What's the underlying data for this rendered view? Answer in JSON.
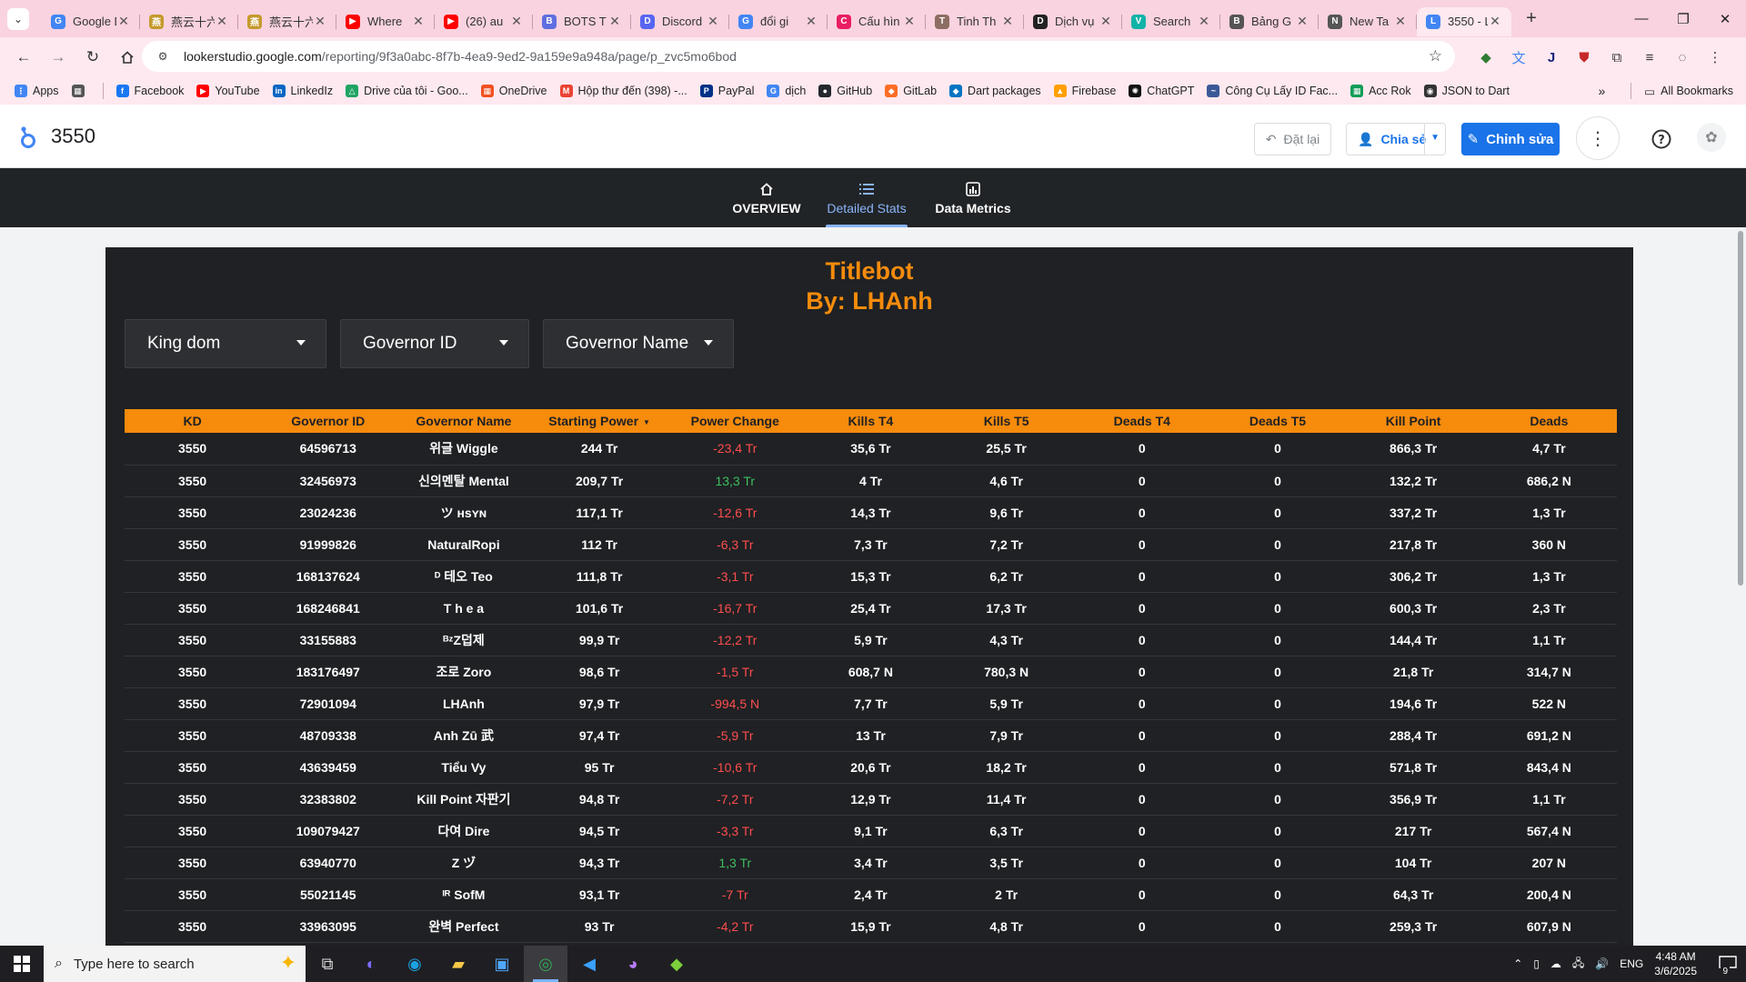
{
  "browser": {
    "tabs": [
      {
        "title": "Google Dịch",
        "favicon_color": "#4285f4",
        "favicon_glyph": "G"
      },
      {
        "title": "燕云十六声",
        "favicon_color": "#c49a2c",
        "favicon_glyph": "燕"
      },
      {
        "title": "燕云十六声",
        "favicon_color": "#c49a2c",
        "favicon_glyph": "燕"
      },
      {
        "title": "Where",
        "favicon_color": "#ff0000",
        "favicon_glyph": "▶"
      },
      {
        "title": "(26) au",
        "favicon_color": "#ff0000",
        "favicon_glyph": "▶"
      },
      {
        "title": "BOTS T",
        "favicon_color": "#5f6ee0",
        "favicon_glyph": "B"
      },
      {
        "title": "Discord",
        "favicon_color": "#5865f2",
        "favicon_glyph": "D"
      },
      {
        "title": "đổi gi",
        "favicon_color": "#4285f4",
        "favicon_glyph": "G"
      },
      {
        "title": "Cấu hìn",
        "favicon_color": "#e91e63",
        "favicon_glyph": "C"
      },
      {
        "title": "Tinh Th",
        "favicon_color": "#8d6e63",
        "favicon_glyph": "T"
      },
      {
        "title": "Dịch vụ",
        "favicon_color": "#222222",
        "favicon_glyph": "D"
      },
      {
        "title": "Search",
        "favicon_color": "#12b3a8",
        "favicon_glyph": "V"
      },
      {
        "title": "Bảng G",
        "favicon_color": "#555555",
        "favicon_glyph": "B"
      },
      {
        "title": "New Ta",
        "favicon_color": "#555555",
        "favicon_glyph": "N"
      },
      {
        "title": "3550 - L",
        "favicon_color": "#4285f4",
        "favicon_glyph": "L",
        "active": true
      }
    ],
    "url_host": "lookerstudio.google.com",
    "url_path": "/reporting/9f3a0abc-8f7b-4ea9-9ed2-9a159e9a948a/page/p_zvc5mo6bod",
    "bookmarks": [
      {
        "label": "Apps",
        "color": "#4285f4",
        "glyph": "⋮"
      },
      {
        "label": "",
        "color": "#555555",
        "glyph": "▦"
      },
      {
        "label": "Facebook",
        "color": "#1877f2",
        "glyph": "f"
      },
      {
        "label": "YouTube",
        "color": "#ff0000",
        "glyph": "▶"
      },
      {
        "label": "LinkedIz",
        "color": "#0a66c2",
        "glyph": "in"
      },
      {
        "label": "Drive của tôi - Goo...",
        "color": "#1fa463",
        "glyph": "△"
      },
      {
        "label": "OneDrive",
        "color": "#f25022",
        "glyph": "▦"
      },
      {
        "label": "Hộp thư đến (398) -...",
        "color": "#ea4335",
        "glyph": "M"
      },
      {
        "label": "PayPal",
        "color": "#003087",
        "glyph": "P"
      },
      {
        "label": "dịch",
        "color": "#4285f4",
        "glyph": "G"
      },
      {
        "label": "GitHub",
        "color": "#24292f",
        "glyph": "●"
      },
      {
        "label": "GitLab",
        "color": "#fc6d26",
        "glyph": "◆"
      },
      {
        "label": "Dart packages",
        "color": "#0175c2",
        "glyph": "◆"
      },
      {
        "label": "Firebase",
        "color": "#ffa000",
        "glyph": "▲"
      },
      {
        "label": "ChatGPT",
        "color": "#111111",
        "glyph": "✺"
      },
      {
        "label": "Công Cụ Lấy ID Fac...",
        "color": "#3b5998",
        "glyph": "~"
      },
      {
        "label": "Acc Rok",
        "color": "#0f9d58",
        "glyph": "▦"
      },
      {
        "label": "JSON to Dart",
        "color": "#333333",
        "glyph": "◉"
      }
    ],
    "all_bookmarks": "All Bookmarks"
  },
  "header": {
    "title": "3550",
    "reset_label": "Đặt lại",
    "share_label": "Chia sẻ",
    "edit_label": "Chỉnh sửa"
  },
  "page_nav": [
    {
      "label": "OVERVIEW",
      "icon": "home-icon"
    },
    {
      "label": "Detailed Stats",
      "icon": "list-icon",
      "active": true
    },
    {
      "label": "Data Metrics",
      "icon": "chart-icon"
    }
  ],
  "report": {
    "title_line1": "Titlebot",
    "title_line2": "By: LHAnh",
    "accent": "#f68b0c",
    "filters": [
      "King dom",
      "Governor ID",
      "Governor Name"
    ],
    "columns": [
      "KD",
      "Governor ID",
      "Governor Name",
      "Starting Power",
      "Power Change",
      "Kills T4",
      "Kills T5",
      "Deads T4",
      "Deads T5",
      "Kill Point",
      "Deads"
    ],
    "sorted_column_index": 3,
    "rows": [
      [
        "3550",
        "64596713",
        "위글 Wiggle",
        "244 Tr",
        "-23,4 Tr",
        "35,6 Tr",
        "25,5 Tr",
        "0",
        "0",
        "866,3 Tr",
        "4,7 Tr"
      ],
      [
        "3550",
        "32456973",
        "신의멘탈 Mental",
        "209,7 Tr",
        "13,3 Tr",
        "4 Tr",
        "4,6 Tr",
        "0",
        "0",
        "132,2 Tr",
        "686,2 N"
      ],
      [
        "3550",
        "23024236",
        "ツ ʜsʏɴ",
        "117,1 Tr",
        "-12,6 Tr",
        "14,3 Tr",
        "9,6 Tr",
        "0",
        "0",
        "337,2 Tr",
        "1,3 Tr"
      ],
      [
        "3550",
        "91999826",
        "NaturalRopi",
        "112 Tr",
        "-6,3 Tr",
        "7,3 Tr",
        "7,2 Tr",
        "0",
        "0",
        "217,8 Tr",
        "360 N"
      ],
      [
        "3550",
        "168137624",
        "ᴰ 테오 Teo",
        "111,8 Tr",
        "-3,1 Tr",
        "15,3 Tr",
        "6,2 Tr",
        "0",
        "0",
        "306,2 Tr",
        "1,3 Tr"
      ],
      [
        "3550",
        "168246841",
        "T h e a",
        "101,6 Tr",
        "-16,7 Tr",
        "25,4 Tr",
        "17,3 Tr",
        "0",
        "0",
        "600,3 Tr",
        "2,3 Tr"
      ],
      [
        "3550",
        "33155883",
        "ᴮᶻZ덥제",
        "99,9 Tr",
        "-12,2 Tr",
        "5,9 Tr",
        "4,3 Tr",
        "0",
        "0",
        "144,4 Tr",
        "1,1 Tr"
      ],
      [
        "3550",
        "183176497",
        "조로 Zoro",
        "98,6 Tr",
        "-1,5 Tr",
        "608,7 N",
        "780,3 N",
        "0",
        "0",
        "21,8 Tr",
        "314,7 N"
      ],
      [
        "3550",
        "72901094",
        "LHAnh",
        "97,9 Tr",
        "-994,5 N",
        "7,7 Tr",
        "5,9 Tr",
        "0",
        "0",
        "194,6 Tr",
        "522 N"
      ],
      [
        "3550",
        "48709338",
        "Anh Zū 武",
        "97,4 Tr",
        "-5,9 Tr",
        "13 Tr",
        "7,9 Tr",
        "0",
        "0",
        "288,4 Tr",
        "691,2 N"
      ],
      [
        "3550",
        "43639459",
        "Tiểu Vy",
        "95 Tr",
        "-10,6 Tr",
        "20,6 Tr",
        "18,2 Tr",
        "0",
        "0",
        "571,8 Tr",
        "843,4 N"
      ],
      [
        "3550",
        "32383802",
        "Kill Point 자판기",
        "94,8 Tr",
        "-7,2 Tr",
        "12,9 Tr",
        "11,4 Tr",
        "0",
        "0",
        "356,9 Tr",
        "1,1 Tr"
      ],
      [
        "3550",
        "109079427",
        "다여 Dire",
        "94,5 Tr",
        "-3,3 Tr",
        "9,1 Tr",
        "6,3 Tr",
        "0",
        "0",
        "217 Tr",
        "567,4 N"
      ],
      [
        "3550",
        "63940770",
        "Z ヅ",
        "94,3 Tr",
        "1,3 Tr",
        "3,4 Tr",
        "3,5 Tr",
        "0",
        "0",
        "104 Tr",
        "207 N"
      ],
      [
        "3550",
        "55021145",
        "ᴵᴿ SofM",
        "93,1 Tr",
        "-7 Tr",
        "2,4 Tr",
        "2 Tr",
        "0",
        "0",
        "64,3 Tr",
        "200,4 N"
      ],
      [
        "3550",
        "33963095",
        "완벽 Perfect",
        "93 Tr",
        "-4,2 Tr",
        "15,9 Tr",
        "4,8 Tr",
        "0",
        "0",
        "259,3 Tr",
        "607,9 N"
      ]
    ]
  },
  "taskbar": {
    "search_placeholder": "Type here to search",
    "apps": [
      "copilot-icon",
      "edge-icon",
      "file-explorer-icon",
      "store-icon",
      "chrome-icon",
      "vscode-icon",
      "discord-icon",
      "bluestacks-icon"
    ],
    "language": "ENG",
    "time": "4:48 AM",
    "date": "3/6/2025",
    "notification_count": "9"
  }
}
